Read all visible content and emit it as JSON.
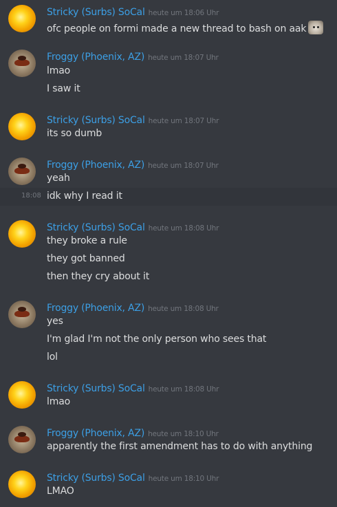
{
  "messages": [
    {
      "author": "Stricky (Surbs) SoCal",
      "time": "heute um 18:06 Uhr",
      "lines": [
        "ofc people on formi made a new thread to bash on aak"
      ]
    },
    {
      "author": "Froggy (Phoenix, AZ)",
      "time": "heute um 18:07 Uhr",
      "lines": [
        "lmao",
        "I saw it"
      ]
    },
    {
      "author": "Stricky (Surbs) SoCal",
      "time": "heute um 18:07 Uhr",
      "lines": [
        "its so dumb"
      ]
    },
    {
      "author": "Froggy (Phoenix, AZ)",
      "time": "heute um 18:07 Uhr",
      "lines": [
        "yeah",
        "idk why I read it"
      ],
      "hover_time": "18:08"
    },
    {
      "author": "Stricky (Surbs) SoCal",
      "time": "heute um 18:08 Uhr",
      "lines": [
        "they broke a rule",
        "they got banned",
        "then they cry about it"
      ]
    },
    {
      "author": "Froggy (Phoenix, AZ)",
      "time": "heute um 18:08 Uhr",
      "lines": [
        "yes",
        "I'm glad I'm not the only person who sees that",
        "lol"
      ]
    },
    {
      "author": "Stricky (Surbs) SoCal",
      "time": "heute um 18:08 Uhr",
      "lines": [
        "lmao"
      ]
    },
    {
      "author": "Froggy (Phoenix, AZ)",
      "time": "heute um 18:10 Uhr",
      "lines": [
        "apparently the first amendment has to do with anything"
      ]
    },
    {
      "author": "Stricky (Surbs) SoCal",
      "time": "heute um 18:10 Uhr",
      "lines": [
        "LMAO"
      ]
    }
  ],
  "colors": {
    "username": "#3c9fe5",
    "background": "#36393f",
    "timestamp": "#72767d",
    "text": "#dcddde"
  },
  "icons": {
    "emoji": "cat-face-emoji"
  }
}
